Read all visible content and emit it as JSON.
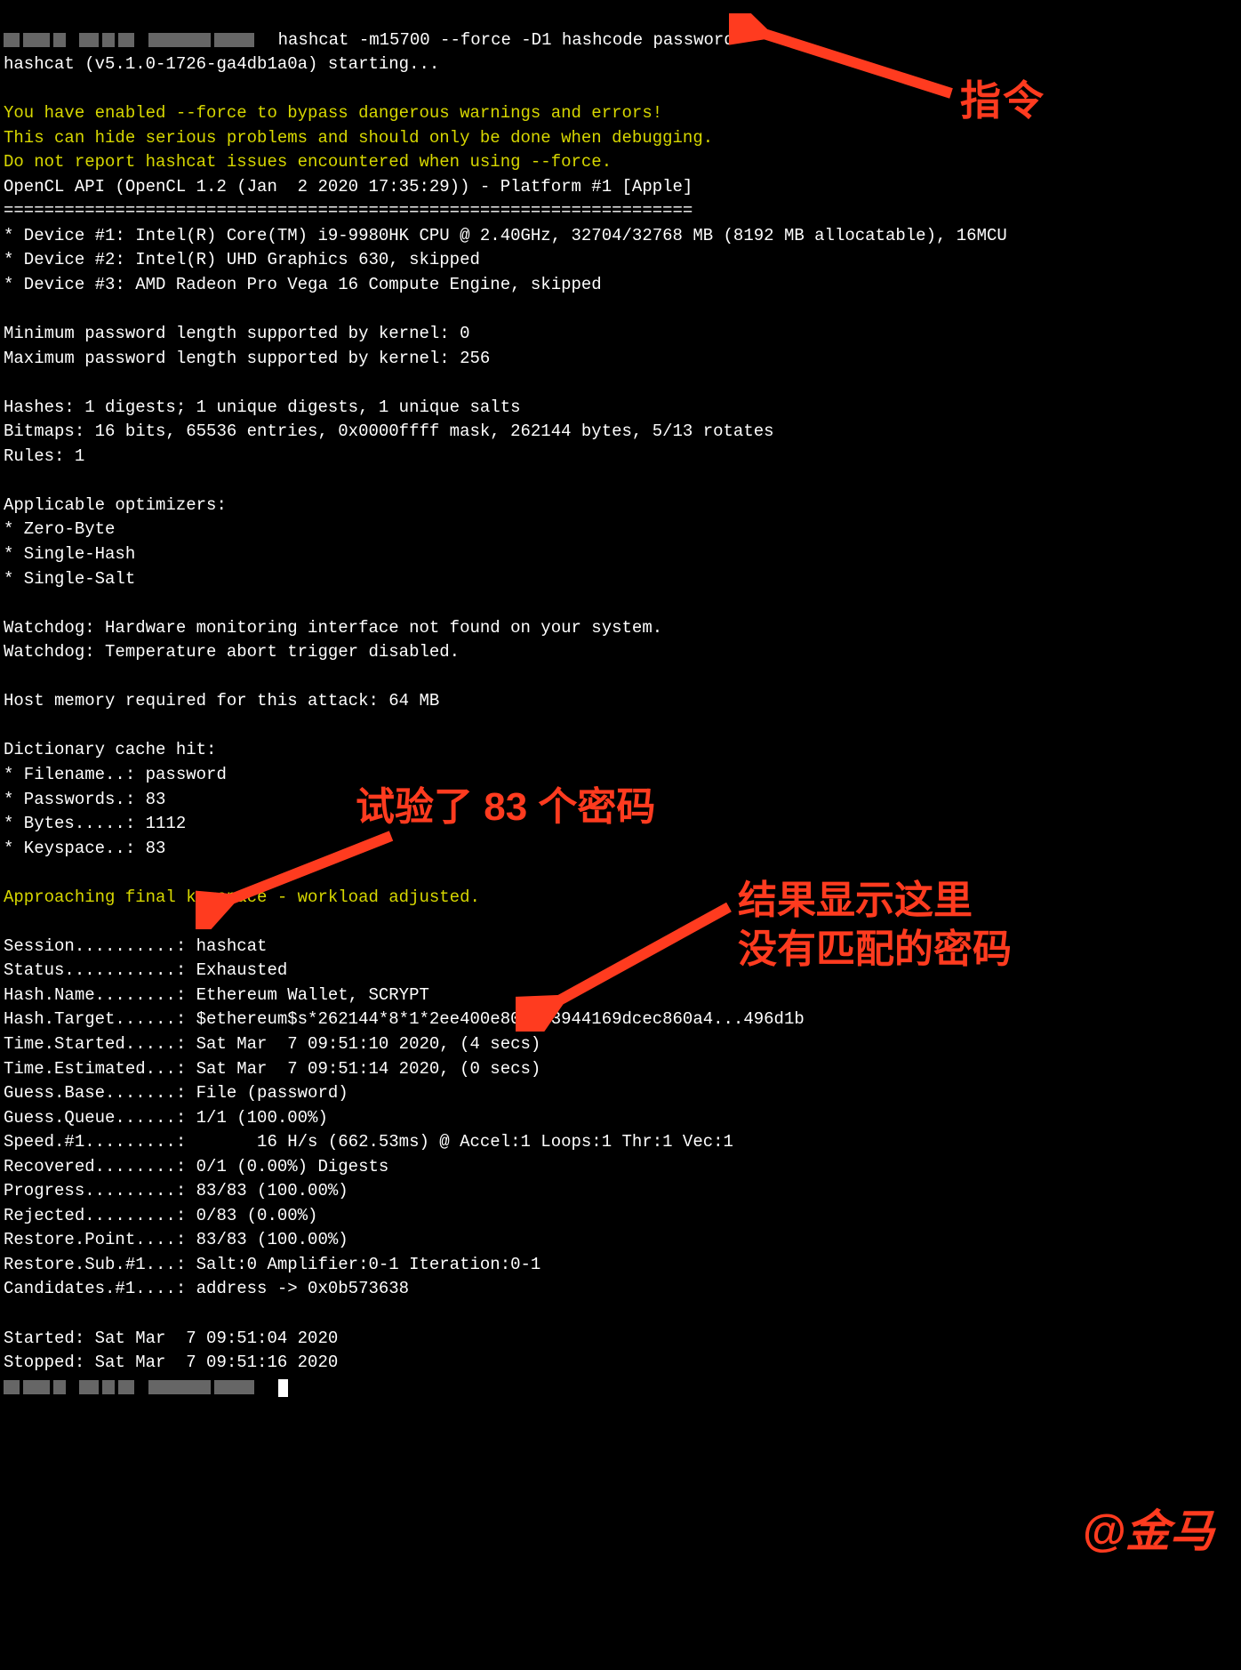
{
  "prompt": {
    "cmd": "hashcat -m15700 --force -D1 hashcode password"
  },
  "starting": "hashcat (v5.1.0-1726-ga4db1a0a) starting...",
  "warn1": "You have enabled --force to bypass dangerous warnings and errors!",
  "warn2": "This can hide serious problems and should only be done when debugging.",
  "warn3": "Do not report hashcat issues encountered when using --force.",
  "opencl": "OpenCL API (OpenCL 1.2 (Jan  2 2020 17:35:29)) - Platform #1 [Apple]",
  "sep": "====================================================================",
  "dev1": "* Device #1: Intel(R) Core(TM) i9-9980HK CPU @ 2.40GHz, 32704/32768 MB (8192 MB allocatable), 16MCU",
  "dev2": "* Device #2: Intel(R) UHD Graphics 630, skipped",
  "dev3": "* Device #3: AMD Radeon Pro Vega 16 Compute Engine, skipped",
  "minpw": "Minimum password length supported by kernel: 0",
  "maxpw": "Maximum password length supported by kernel: 256",
  "hashes": "Hashes: 1 digests; 1 unique digests, 1 unique salts",
  "bitmaps": "Bitmaps: 16 bits, 65536 entries, 0x0000ffff mask, 262144 bytes, 5/13 rotates",
  "rules": "Rules: 1",
  "opt_hdr": "Applicable optimizers:",
  "opt1": "* Zero-Byte",
  "opt2": "* Single-Hash",
  "opt3": "* Single-Salt",
  "wd1": "Watchdog: Hardware monitoring interface not found on your system.",
  "wd2": "Watchdog: Temperature abort trigger disabled.",
  "hostmem": "Host memory required for this attack: 64 MB",
  "dict_hdr": "Dictionary cache hit:",
  "dict_fn": "* Filename..: password",
  "dict_pw": "* Passwords.: 83",
  "dict_by": "* Bytes.....: 1112",
  "dict_ks": "* Keyspace..: 83",
  "approach": "Approaching final keyspace - workload adjusted.",
  "status": {
    "session": "Session..........: hashcat",
    "status": "Status...........: Exhausted",
    "hashname": "Hash.Name........: Ethereum Wallet, SCRYPT",
    "hashtgt": "Hash.Target......: $ethereum$s*262144*8*1*2ee400e80b643944169dcec860a4...496d1b",
    "tstart": "Time.Started.....: Sat Mar  7 09:51:10 2020, (4 secs)",
    "test": "Time.Estimated...: Sat Mar  7 09:51:14 2020, (0 secs)",
    "gbase": "Guess.Base.......: File (password)",
    "gqueue": "Guess.Queue......: 1/1 (100.00%)",
    "speed": "Speed.#1.........:       16 H/s (662.53ms) @ Accel:1 Loops:1 Thr:1 Vec:1",
    "recov": "Recovered........: 0/1 (0.00%) Digests",
    "prog": "Progress.........: 83/83 (100.00%)",
    "rej": "Rejected.........: 0/83 (0.00%)",
    "rpoint": "Restore.Point....: 83/83 (100.00%)",
    "rsub": "Restore.Sub.#1...: Salt:0 Amplifier:0-1 Iteration:0-1",
    "cand": "Candidates.#1....: address -> 0x0b573638"
  },
  "started": "Started: Sat Mar  7 09:51:04 2020",
  "stopped": "Stopped: Sat Mar  7 09:51:16 2020",
  "anno": {
    "cmd_label": "指令",
    "tried_label": "试验了 83 个密码",
    "result_label": "结果显示这里\n没有匹配的密码",
    "sig": "@金马"
  },
  "colors": {
    "red": "#ff3b1f",
    "yellow": "#d7d700"
  }
}
